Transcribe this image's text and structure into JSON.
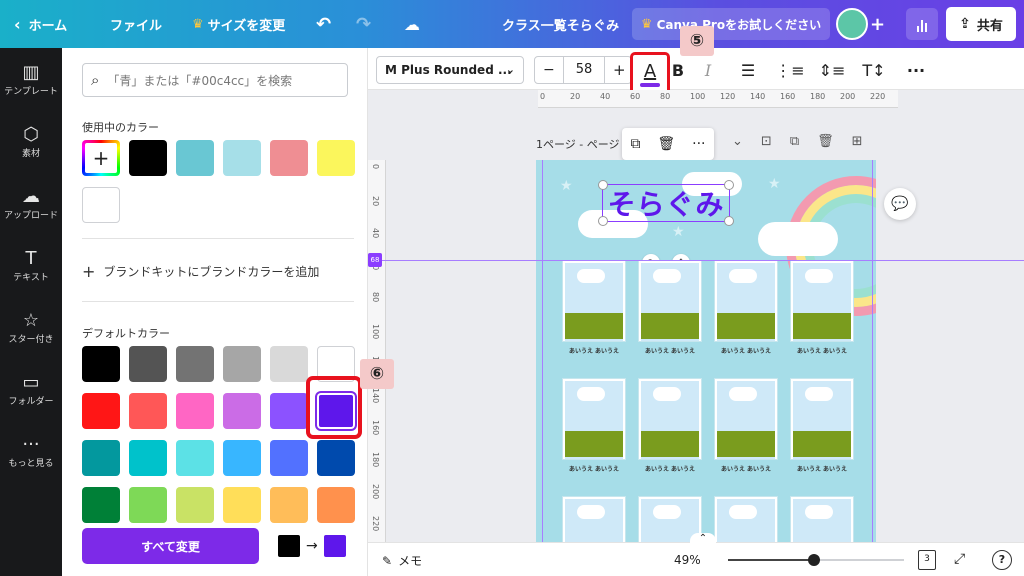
{
  "topbar": {
    "home": "ホーム",
    "file": "ファイル",
    "resize": "サイズを変更",
    "doc_title": "クラス一覧そらぐみ",
    "try_pro": "Canva Proをお試しください",
    "share": "共有"
  },
  "sidebar": [
    {
      "label": "テンプレート",
      "icon": "layout-icon"
    },
    {
      "label": "素材",
      "icon": "shapes-icon"
    },
    {
      "label": "アップロード",
      "icon": "cloud-upload-icon"
    },
    {
      "label": "テキスト",
      "icon": "text-icon"
    },
    {
      "label": "スター付き",
      "icon": "star-icon"
    },
    {
      "label": "フォルダー",
      "icon": "folder-icon"
    },
    {
      "label": "もっと見る",
      "icon": "more-icon"
    }
  ],
  "panel": {
    "search_placeholder": "「青」または「#00c4cc」を検索",
    "used_colors_title": "使用中のカラー",
    "used_colors": [
      "#000000",
      "#69c7d3",
      "#a6dfe8",
      "#ef8e93",
      "#fbf65c",
      "#ffffff"
    ],
    "brand_kit": "ブランドキットにブランドカラーを追加",
    "default_colors_title": "デフォルトカラー",
    "default_colors": [
      "#000000",
      "#545454",
      "#737373",
      "#a6a6a6",
      "#d9d9d9",
      "#ffffff",
      "#ff1616",
      "#ff5757",
      "#ff66c4",
      "#cb6ce6",
      "#8c52ff",
      "#5e17eb",
      "#03989e",
      "#00c2cb",
      "#5ce1e6",
      "#38b6ff",
      "#5271ff",
      "#004aad",
      "#008037",
      "#7ed957",
      "#c9e265",
      "#ffde59",
      "#ffbd59",
      "#ff914d"
    ],
    "selected_color": "#5e17eb",
    "apply_all": "すべて変更",
    "from_color": "#000000",
    "to_color": "#5e17eb",
    "arrow": "→"
  },
  "toolbar": {
    "font": "M Plus Rounded ...",
    "font_size": "58",
    "minus": "−",
    "plus": "+",
    "text_color_letter": "A",
    "text_color": "#7d2ae8",
    "bold": "B",
    "italic": "I"
  },
  "ruler": {
    "top_ticks": [
      "0",
      "20",
      "40",
      "60",
      "80",
      "100",
      "120",
      "140",
      "160",
      "180",
      "200",
      "220"
    ],
    "left_ticks": [
      "0",
      "20",
      "40",
      "60",
      "80",
      "100",
      "120",
      "140",
      "160",
      "180",
      "200",
      "220"
    ],
    "guide_badge": "68"
  },
  "page": {
    "label": "1ページ - ページ",
    "title_text": "そらぐみ",
    "title_color": "#5e17eb",
    "card_caption": "あいうえ あいうえ"
  },
  "bottombar": {
    "notes": "メモ",
    "zoom": "49%",
    "zoom_fraction": 0.49,
    "page_count": "3"
  },
  "markers": {
    "text_color": "⑤",
    "swatch": "⑥"
  }
}
